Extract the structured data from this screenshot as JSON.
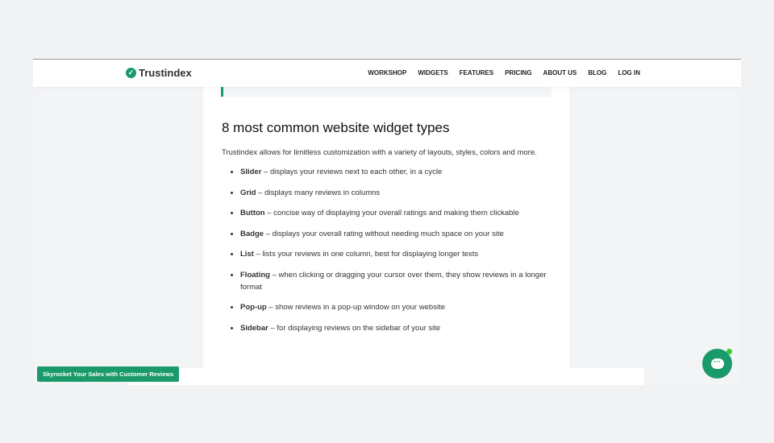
{
  "nav": {
    "brand": "Trustindex",
    "items": [
      "WORKSHOP",
      "WIDGETS",
      "FEATURES",
      "PRICING",
      "ABOUT US",
      "BLOG",
      "LOG IN"
    ]
  },
  "article": {
    "heading": "8 most common website widget types",
    "intro": "Trustindex allows for limitless customization with a variety of layouts, styles, colors and more.",
    "items": [
      {
        "term": "Slider",
        "desc": " – displays your reviews next to each other, in a cycle"
      },
      {
        "term": "Grid",
        "desc": " – displays many reviews in columns"
      },
      {
        "term": "Button",
        "desc": " – concise way of displaying your overall ratings and making them clickable"
      },
      {
        "term": "Badge",
        "desc": " – displays your overall rating without needing much space on your site"
      },
      {
        "term": "List",
        "desc": " – lists your reviews in one column, best for displaying longer texts"
      },
      {
        "term": "Floating",
        "desc": " – when clicking or dragging your cursor over them, they show reviews in a longer format"
      },
      {
        "term": "Pop-up",
        "desc": " – show reviews in a pop-up window on your website"
      },
      {
        "term": "Sidebar",
        "desc": " – for displaying reviews on the sidebar of your site"
      }
    ]
  },
  "cta": "Skyrocket Your Sales with Customer Reviews",
  "chat_icon": "chat-bubble-icon",
  "accent": "#1a9a6b"
}
